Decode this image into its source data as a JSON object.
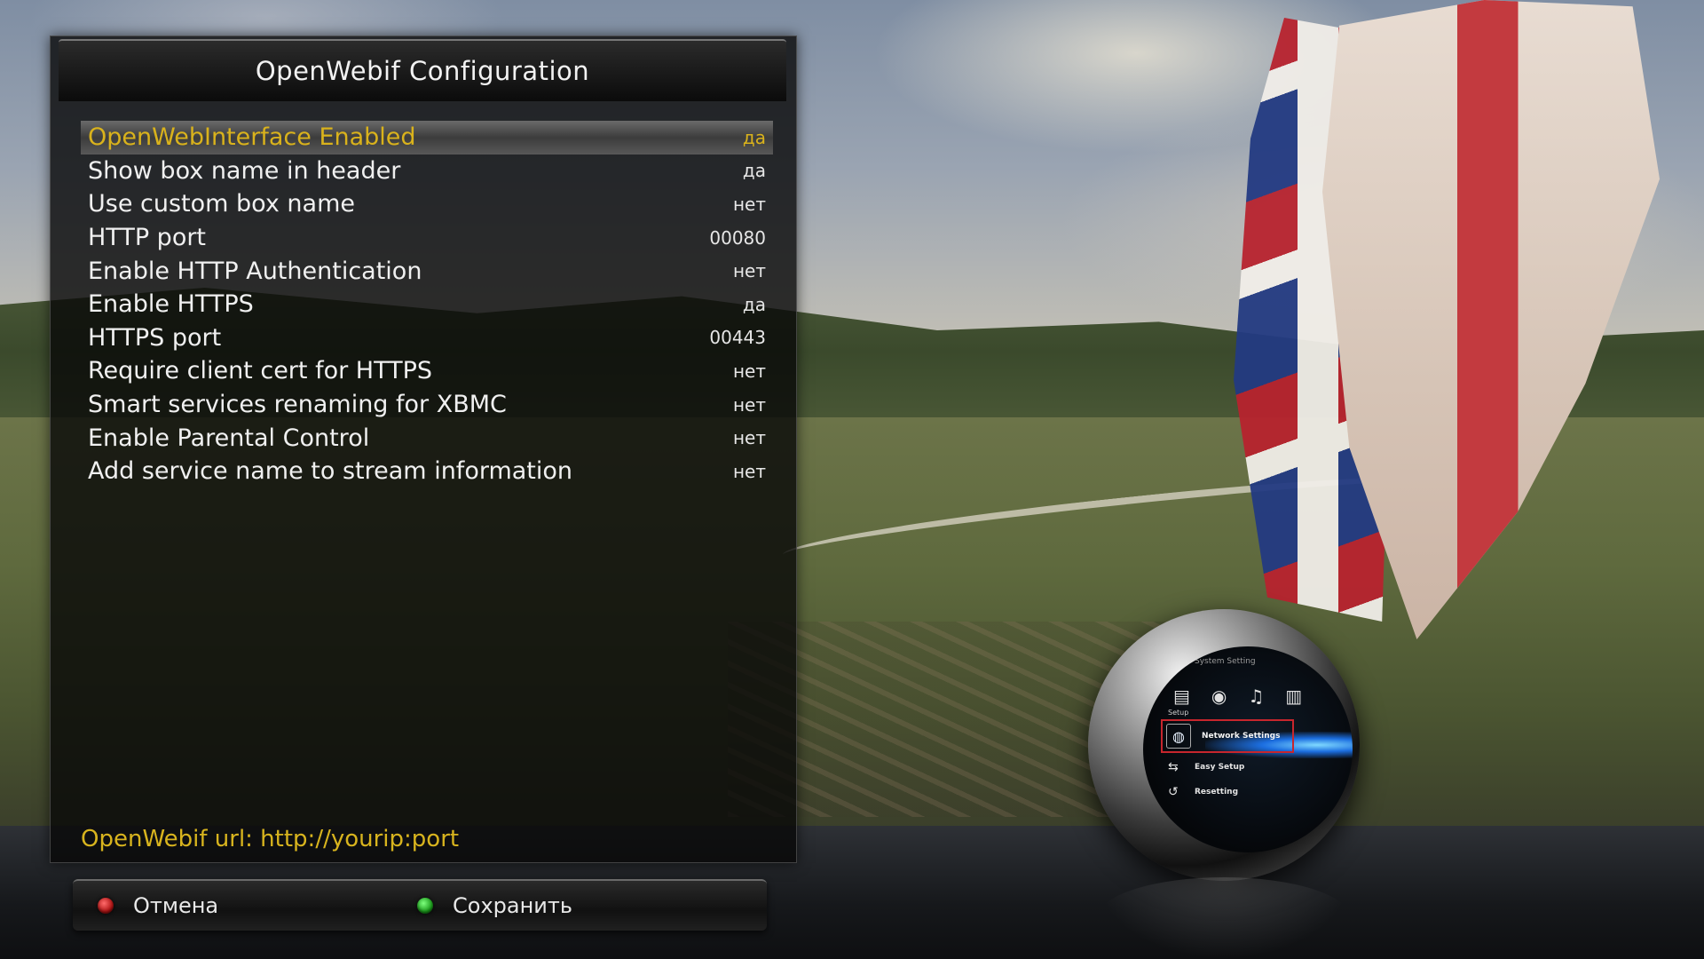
{
  "panel": {
    "title": "OpenWebif Configuration",
    "settings": [
      {
        "label": "OpenWebInterface Enabled",
        "value": "да"
      },
      {
        "label": "Show box name in header",
        "value": "да"
      },
      {
        "label": "Use custom box name",
        "value": "нет"
      },
      {
        "label": "HTTP port",
        "value": "00080"
      },
      {
        "label": "Enable HTTP Authentication",
        "value": "нет"
      },
      {
        "label": "Enable HTTPS",
        "value": "да"
      },
      {
        "label": "HTTPS port",
        "value": "00443"
      },
      {
        "label": "Require client cert for HTTPS",
        "value": "нет"
      },
      {
        "label": "Smart services renaming for XBMC",
        "value": "нет"
      },
      {
        "label": "Enable Parental Control",
        "value": "нет"
      },
      {
        "label": "Add service name to stream information",
        "value": "нет"
      }
    ],
    "selected_index": 0,
    "hint": "OpenWebif url: http://yourip:port",
    "buttons": {
      "red_label": "Отмена",
      "green_label": "Сохранить"
    }
  },
  "orb": {
    "caption": "System Setting",
    "setup_label": "Setup",
    "menu": {
      "selected": "Network Settings",
      "items": [
        "Easy Setup",
        "Resetting"
      ]
    }
  },
  "colors": {
    "selection_text": "#d9b21c",
    "hint_text": "#d8b41e",
    "red_button": "#b01515",
    "green_button": "#1c9c1c",
    "orb_highlight": "#c7262d"
  }
}
